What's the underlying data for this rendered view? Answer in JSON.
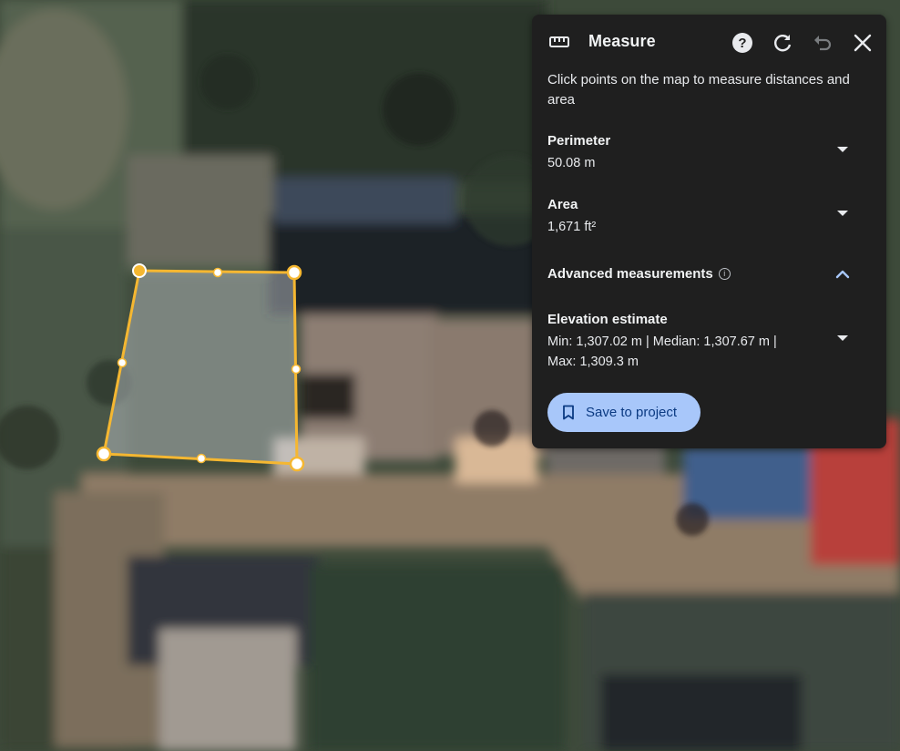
{
  "measure_panel": {
    "title": "Measure",
    "description": "Click points on the map to measure distances and area",
    "perimeter": {
      "label": "Perimeter",
      "value": "50.08 m"
    },
    "area": {
      "label": "Area",
      "value": "1,671 ft²"
    },
    "advanced": {
      "label": "Advanced measurements",
      "info_icon": "info-icon",
      "expanded": true
    },
    "elevation": {
      "label": "Elevation estimate",
      "value_line1": "Min: 1,307.02 m | Median: 1,307.67 m |",
      "value_line2": "Max: 1,309.3 m"
    },
    "save_label": "Save to project",
    "icons": [
      "ruler-icon",
      "help-icon",
      "refresh-icon",
      "undo-icon",
      "close-icon",
      "chevron-down-icon",
      "chevron-up-icon",
      "bookmark-icon"
    ]
  },
  "colors": {
    "panel_bg": "#1f1f1f",
    "accent_blue": "#a8c7fa",
    "polygon_stroke": "#f5b731",
    "undo_disabled": "#7a7d80"
  }
}
